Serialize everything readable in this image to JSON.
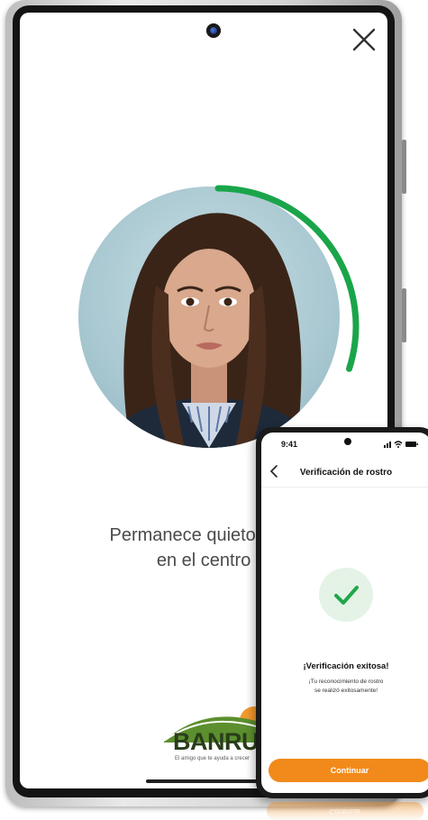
{
  "back_screen": {
    "instruction_line1": "Permanece quieto, colc",
    "instruction_line2": "en el centro del c",
    "progress_fraction": 0.3
  },
  "logo": {
    "brand": "BANRURAL",
    "tagline": "El amigo que te ayuda a crecer"
  },
  "front_screen": {
    "status": {
      "time": "9:41"
    },
    "nav": {
      "title": "Verificación de rostro"
    },
    "success": {
      "title": "¡Verificación exitosa!",
      "subtitle_line1": "¡Tu reconocimiento de rostro",
      "subtitle_line2": "se realizó exitosamente!"
    },
    "button": {
      "label": "Continuar"
    },
    "reflection_label": "Continuar"
  },
  "colors": {
    "progress": "#1aa54a",
    "accent": "#f18a1a",
    "success_bg": "#e4f3e6",
    "check": "#21a64a"
  },
  "icons": {
    "close": "close-icon",
    "back": "chevron-left-icon",
    "check": "check-icon",
    "signal": "signal-icon",
    "wifi": "wifi-icon",
    "battery": "battery-icon"
  }
}
